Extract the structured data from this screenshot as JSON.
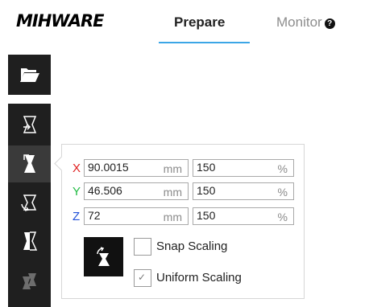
{
  "header": {
    "logo": "MIHWARE",
    "tabs": [
      {
        "label": "Prepare",
        "active": true
      },
      {
        "label": "Monitor",
        "active": false,
        "icon": "question-circle-icon"
      }
    ],
    "accent_color": "#3ca6e6"
  },
  "toolbar": {
    "open_button": {
      "icon": "folder-open-icon"
    },
    "tools": [
      {
        "icon": "translate-tool-icon",
        "active": false
      },
      {
        "icon": "scale-tool-icon",
        "active": true
      },
      {
        "icon": "rotate-tool-icon",
        "active": false
      },
      {
        "icon": "mirror-tool-icon",
        "active": false
      },
      {
        "icon": "per-object-settings-icon",
        "active": false
      }
    ]
  },
  "scale_panel": {
    "rows": [
      {
        "axis": "X",
        "color": "#e02020",
        "size": "90.0015",
        "size_unit": "mm",
        "percent": "150",
        "percent_unit": "%"
      },
      {
        "axis": "Y",
        "color": "#22bb44",
        "size": "46.506",
        "size_unit": "mm",
        "percent": "150",
        "percent_unit": "%"
      },
      {
        "axis": "Z",
        "color": "#2050d8",
        "size": "72",
        "size_unit": "mm",
        "percent": "150",
        "percent_unit": "%"
      }
    ],
    "lay_flat_button_icon": "scale-to-max-icon",
    "snap_scaling": {
      "label": "Snap Scaling",
      "checked": false
    },
    "uniform_scaling": {
      "label": "Uniform Scaling",
      "checked": true
    }
  }
}
